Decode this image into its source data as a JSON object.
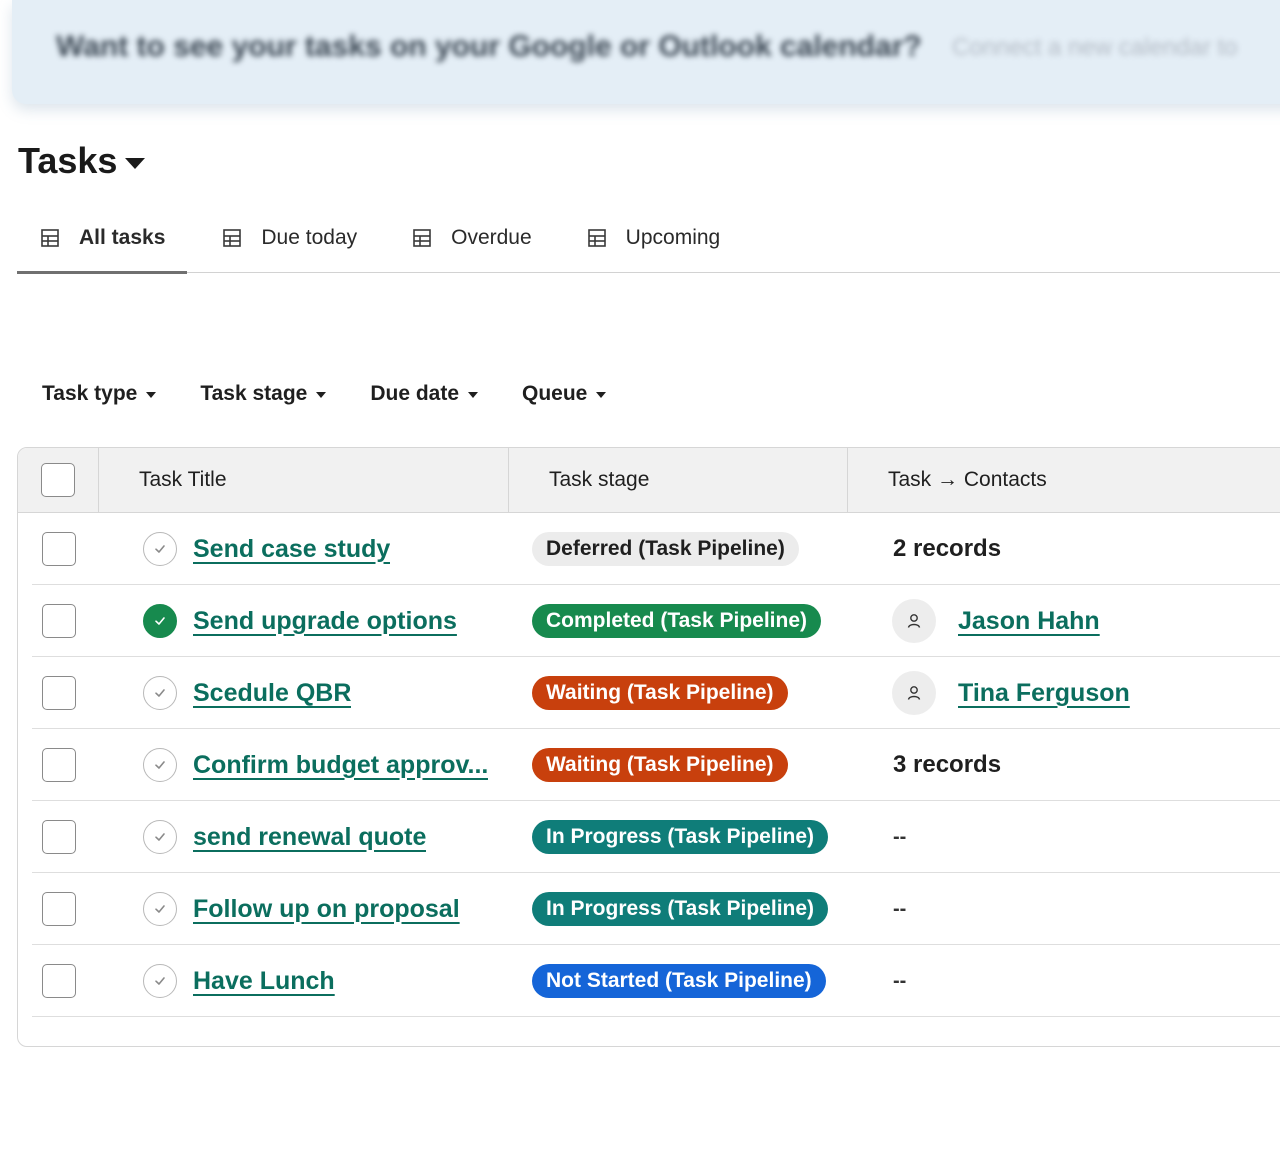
{
  "banner": {
    "text": "Want to see your tasks on your Google or Outlook calendar?",
    "link": "Connect a new calendar to"
  },
  "header": {
    "title": "Tasks"
  },
  "tabs": [
    {
      "label": "All tasks",
      "icon": "table-icon",
      "active": true
    },
    {
      "label": "Due today",
      "icon": "table-icon"
    },
    {
      "label": "Overdue",
      "icon": "table-icon"
    },
    {
      "label": "Upcoming",
      "icon": "table-icon"
    }
  ],
  "filters": [
    "Task type",
    "Task stage",
    "Due date",
    "Queue"
  ],
  "table": {
    "columns": {
      "title": "Task Title",
      "stage": "Task stage",
      "contacts": "Task → Contacts"
    },
    "rows": [
      {
        "title": "Send case study",
        "completed": false,
        "stage": "Deferred (Task Pipeline)",
        "stage_bg": "#ececec",
        "stage_fg": "#1f1f1f",
        "contacts_type": "count",
        "contacts": "2 records"
      },
      {
        "title": "Send upgrade options",
        "completed": true,
        "stage": "Completed (Task Pipeline)",
        "stage_bg": "#178a4e",
        "stage_fg": "#ffffff",
        "contacts_type": "person",
        "contacts": "Jason Hahn"
      },
      {
        "title": "Scedule QBR",
        "completed": false,
        "stage": "Waiting (Task Pipeline)",
        "stage_bg": "#c8400d",
        "stage_fg": "#ffffff",
        "contacts_type": "person",
        "contacts": "Tina Ferguson"
      },
      {
        "title": "Confirm budget approv...",
        "completed": false,
        "stage": "Waiting (Task Pipeline)",
        "stage_bg": "#c8400d",
        "stage_fg": "#ffffff",
        "contacts_type": "count",
        "contacts": "3 records"
      },
      {
        "title": "send renewal quote",
        "completed": false,
        "stage": "In Progress (Task Pipeline)",
        "stage_bg": "#0f7d79",
        "stage_fg": "#ffffff",
        "contacts_type": "empty",
        "contacts": "--"
      },
      {
        "title": "Follow up on proposal",
        "completed": false,
        "stage": "In Progress (Task Pipeline)",
        "stage_bg": "#0f7d79",
        "stage_fg": "#ffffff",
        "contacts_type": "empty",
        "contacts": "--"
      },
      {
        "title": "Have Lunch",
        "completed": false,
        "stage": "Not Started (Task Pipeline)",
        "stage_bg": "#1565d8",
        "stage_fg": "#ffffff",
        "contacts_type": "empty",
        "contacts": "--"
      }
    ]
  },
  "colors": {
    "link": "#0b6e5e",
    "complete": "#178a4e"
  }
}
